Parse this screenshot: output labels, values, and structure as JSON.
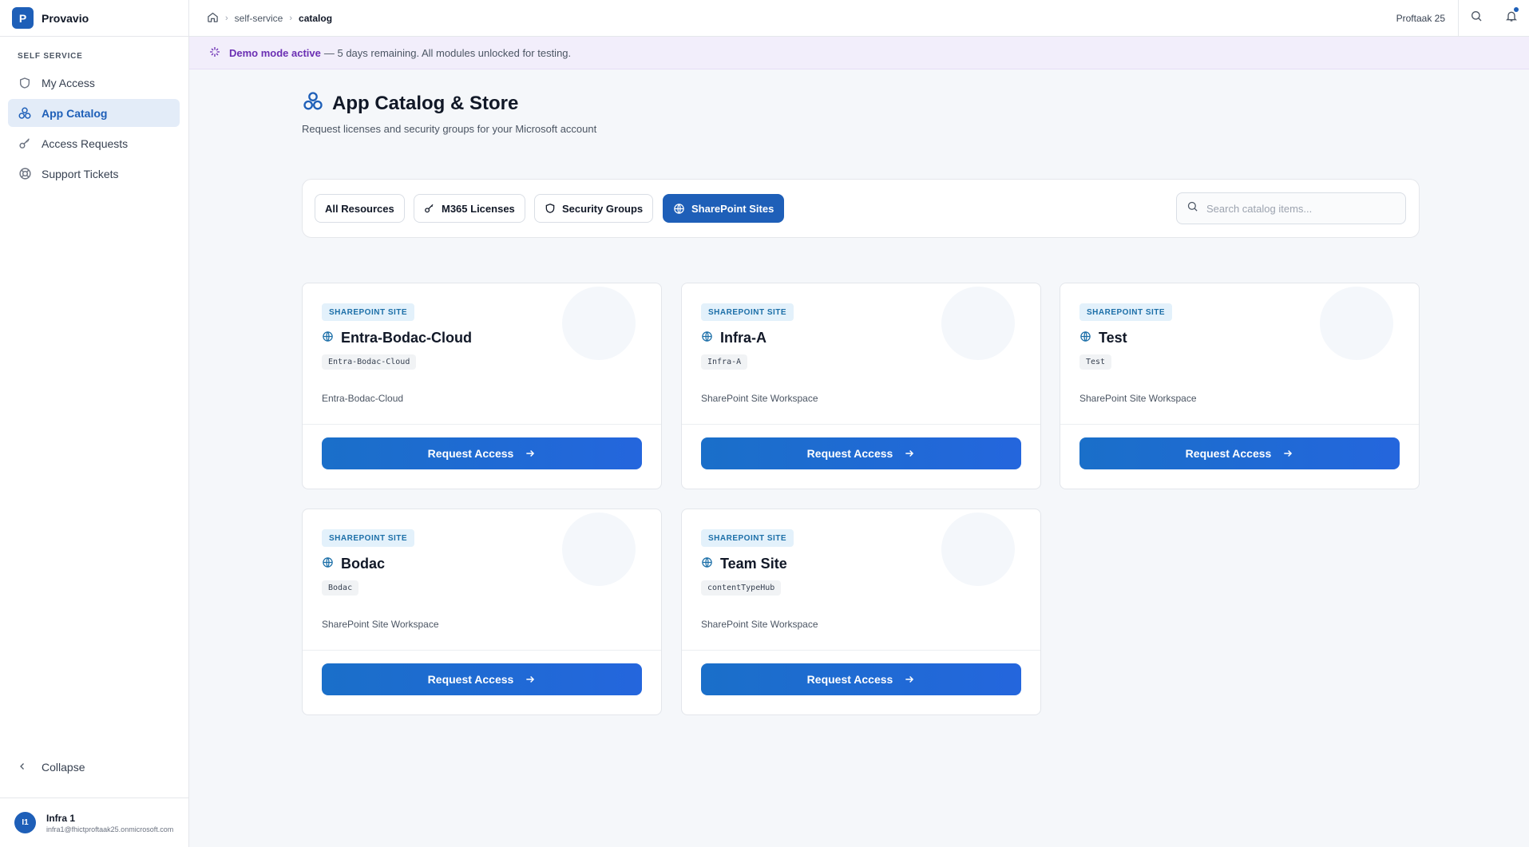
{
  "app": {
    "logo_letter": "P",
    "name": "Provavio"
  },
  "sidebar": {
    "section_label": "SELF SERVICE",
    "items": [
      {
        "label": "My Access",
        "icon": "shield-icon"
      },
      {
        "label": "App Catalog",
        "icon": "catalog-icon",
        "active": true
      },
      {
        "label": "Access Requests",
        "icon": "key-icon"
      },
      {
        "label": "Support Tickets",
        "icon": "lifebuoy-icon"
      }
    ],
    "collapse_label": "Collapse"
  },
  "user": {
    "initials": "I1",
    "name": "Infra 1",
    "email": "infra1@fhictproftaak25.onmicrosoft.com"
  },
  "topbar": {
    "breadcrumb": [
      "self-service",
      "catalog"
    ],
    "tenant": "Proftaak 25"
  },
  "banner": {
    "strong": "Demo mode active",
    "text": "— 5 days remaining. All modules unlocked for testing."
  },
  "page": {
    "title": "App Catalog & Store",
    "subtitle": "Request licenses and security groups for your Microsoft account"
  },
  "filters": {
    "chips": [
      "All Resources",
      "M365 Licenses",
      "Security Groups",
      "SharePoint Sites"
    ],
    "active": "SharePoint Sites",
    "search_placeholder": "Search catalog items..."
  },
  "cards": [
    {
      "badge": "SHAREPOINT SITE",
      "title": "Entra-Bodac-Cloud",
      "code": "Entra-Bodac-Cloud",
      "description": "Entra-Bodac-Cloud",
      "button": "Request Access"
    },
    {
      "badge": "SHAREPOINT SITE",
      "title": "Infra-A",
      "code": "Infra-A",
      "description": "SharePoint Site Workspace",
      "button": "Request Access"
    },
    {
      "badge": "SHAREPOINT SITE",
      "title": "Test",
      "code": "Test",
      "description": "SharePoint Site Workspace",
      "button": "Request Access"
    },
    {
      "badge": "SHAREPOINT SITE",
      "title": "Bodac",
      "code": "Bodac",
      "description": "SharePoint Site Workspace",
      "button": "Request Access"
    },
    {
      "badge": "SHAREPOINT SITE",
      "title": "Team Site",
      "code": "contentTypeHub",
      "description": "SharePoint Site Workspace",
      "button": "Request Access"
    }
  ],
  "colors": {
    "primary": "#1e5fb8",
    "banner_bg": "#f2eefb",
    "banner_accent": "#6b2fb3",
    "badge_bg": "#e3f1fb"
  }
}
